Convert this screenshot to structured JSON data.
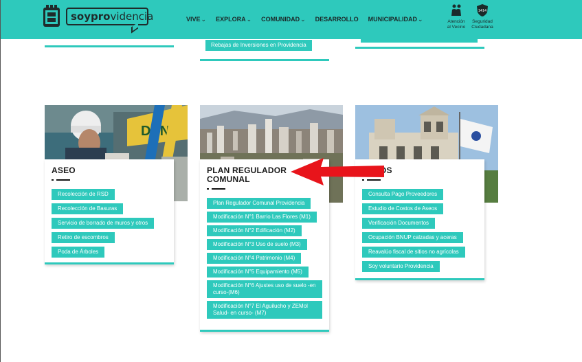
{
  "header": {
    "logo_bold": "soypro",
    "logo_light": "videncia",
    "nav": [
      {
        "label": "VIVE",
        "dropdown": true
      },
      {
        "label": "EXPLORA",
        "dropdown": true
      },
      {
        "label": "COMUNIDAD",
        "dropdown": true
      },
      {
        "label": "DESARROLLO",
        "dropdown": false
      },
      {
        "label": "MUNICIPALIDAD",
        "dropdown": true
      }
    ],
    "tools": [
      {
        "line1": "Atención",
        "line2": "al Vecino",
        "icon": "people-icon"
      },
      {
        "line1": "Seguridad",
        "line2": "Ciudadana",
        "icon": "shield-1414-icon",
        "badge": "1414"
      }
    ]
  },
  "top_partial": {
    "middle_link": "Rebajas de Inversiones en Providencia"
  },
  "cards": [
    {
      "title": "ASEO",
      "links": [
        "Recolección de RSD",
        "Recolección de Basuras",
        "Servicio de borrado de muros y otros",
        "Retiro de escombros",
        "Poda de Árboles"
      ]
    },
    {
      "title": "PLAN REGULADOR COMUNAL",
      "links": [
        "Plan Regulador Comunal Providencia",
        "Modificación N°1 Barrio Las Flores (M1)",
        "Modificación N°2 Edificación (M2)",
        "Modificación N°3 Uso de suelo (M3)",
        "Modificación N°4 Patrimonio (M4)",
        "Modificación N°5 Equipamiento (M5)",
        "Modificación N°6 Ajustes uso de suelo -en curso-(M6)",
        "Modificación N°7 El Aguilucho y ZEMol Salud- en curso- (M7)"
      ]
    },
    {
      "title": "OTROS",
      "links": [
        "Consulta Pago Proveedores",
        "Estudio de Costos de Aseos",
        "Verificación Documentos",
        "Ocupación BNUP calzadas y aceras",
        "Reavalúo fiscal de sitios no agrícolas",
        "Soy voluntario Providencia"
      ]
    }
  ],
  "colors": {
    "accent": "#2ec9bc",
    "arrow": "#e8141b"
  }
}
